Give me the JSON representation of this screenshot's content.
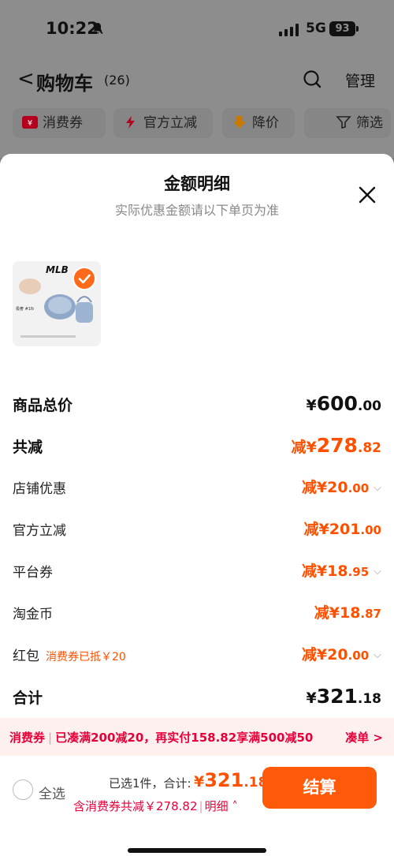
{
  "status_bar": {
    "time": "10:22",
    "network": "5G",
    "battery": "93"
  },
  "nav": {
    "back": "<",
    "title": "购物车",
    "count": "(26)",
    "manage": "管理"
  },
  "chips": [
    {
      "label": "消费券"
    },
    {
      "label": "官方立减"
    },
    {
      "label": "降价"
    },
    {
      "label": "筛选"
    }
  ],
  "sheet": {
    "title": "金额明细",
    "subtitle": "实际优惠金额请以下单页为准",
    "product": {
      "brand": "MLB",
      "caption": "极奢 #1N"
    },
    "rows": [
      {
        "label": "商品总价",
        "prefix": "¥",
        "int": "600",
        "dec": ".00"
      },
      {
        "label": "共减",
        "prefix": "减¥",
        "int": "278",
        "dec": ".82"
      },
      {
        "label": "店铺优惠",
        "prefix": "减¥",
        "int": "20",
        "dec": ".00"
      },
      {
        "label": "官方立减",
        "prefix": "减¥",
        "int": "201",
        "dec": ".00"
      },
      {
        "label": "平台券",
        "prefix": "减¥",
        "int": "18",
        "dec": ".95"
      },
      {
        "label": "淘金币",
        "prefix": "减¥",
        "int": "18",
        "dec": ".87"
      },
      {
        "label": "红包",
        "note": "消费券已抵￥20",
        "prefix": "减¥",
        "int": "20",
        "dec": ".00"
      },
      {
        "label": "合计",
        "prefix": "¥",
        "int": "321",
        "dec": ".18"
      }
    ]
  },
  "banner": {
    "tag": "消费券",
    "text": "已凑满200减20，再实付158.82享满500减50",
    "action": "凑单 >"
  },
  "footer": {
    "select_all": "全选",
    "selected_info": "已选1件，合计:",
    "total_prefix": "¥",
    "total_int": "321",
    "total_dec": ".18",
    "discount": "含消费券共减￥278.82",
    "detail": "明细",
    "checkout": "结算"
  },
  "colors": {
    "accent": "#ff5000",
    "checkout": "#ff5a0a",
    "banner_text": "#e6003a"
  }
}
